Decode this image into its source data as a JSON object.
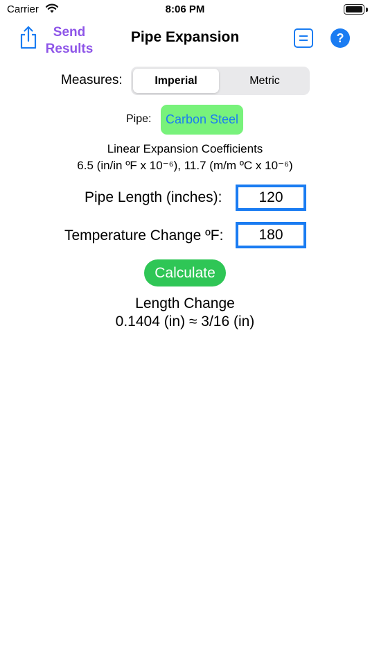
{
  "status_bar": {
    "carrier": "Carrier",
    "time": "8:06 PM",
    "wifi_icon": "wifi-icon",
    "battery_icon": "battery-icon"
  },
  "nav": {
    "share_icon": "share-icon",
    "send_results_label": "Send Results",
    "title": "Pipe Expansion",
    "list_icon": "list-icon",
    "help_icon_glyph": "?"
  },
  "measures": {
    "label": "Measures:",
    "options": [
      "Imperial",
      "Metric"
    ],
    "selected": "Imperial"
  },
  "pipe": {
    "label": "Pipe:",
    "value": "Carbon Steel"
  },
  "coefficients": {
    "title": "Linear Expansion Coefficients",
    "values": "6.5 (in/in ºF x 10⁻⁶), 11.7 (m/m ºC x 10⁻⁶)"
  },
  "inputs": {
    "pipe_length_label": "Pipe Length (inches):",
    "pipe_length_value": "120",
    "temp_change_label": "Temperature Change ºF:",
    "temp_change_value": "180"
  },
  "calculate_label": "Calculate",
  "result": {
    "title": "Length Change",
    "value": "0.1404 (in) ≈ 3/16 (in)"
  },
  "colors": {
    "accent_blue": "#1a7cf2",
    "send_purple": "#8e55e8",
    "pipe_green": "#78f27b",
    "calculate_green": "#2fc656"
  }
}
